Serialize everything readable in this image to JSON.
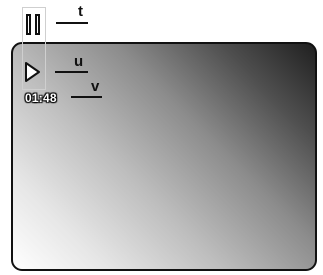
{
  "callouts": {
    "t": "t",
    "u": "u",
    "v": "v"
  },
  "screen": {
    "time_display": "01:48"
  },
  "icons": {
    "pause": "pause-icon",
    "play": "play-icon"
  },
  "colors": {
    "stroke": "#111111",
    "gradient_light": "#ffffff",
    "gradient_dark": "#202020"
  }
}
